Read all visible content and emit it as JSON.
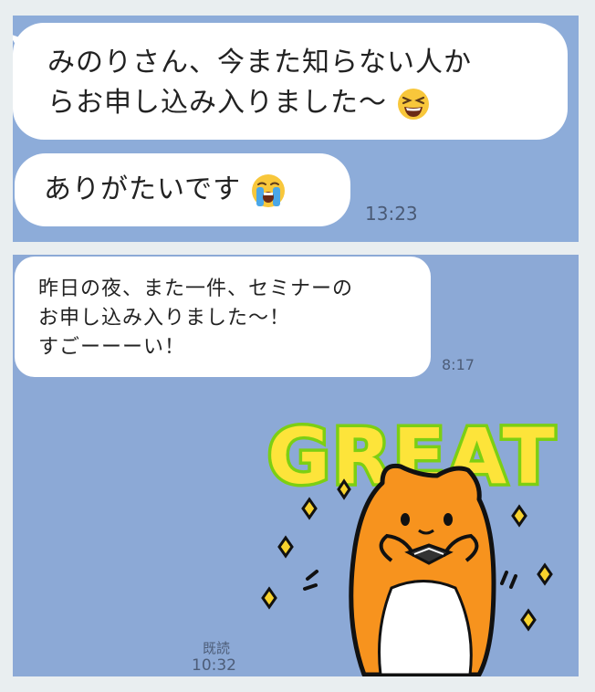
{
  "messages": [
    {
      "lines": [
        "みのりさん、今また知らない人か",
        "らお申し込み入りました〜"
      ],
      "emoji": "laughing-face-icon"
    },
    {
      "text": "ありがたいです",
      "emoji": "crying-face-icon",
      "time": "13:23"
    },
    {
      "lines": [
        "昨日の夜、また一件、セミナーの",
        "お申し込み入りました〜！",
        "すごーーーい！"
      ],
      "time": "8:17"
    }
  ],
  "sticker": {
    "text": "GREAT",
    "icon": "hamster-great-sticker"
  },
  "status": {
    "read": "既読",
    "time": "10:32"
  },
  "colors": {
    "chat_background": "#8dacd9",
    "bubble": "#ffffff",
    "sticker_orange": "#f7931e",
    "sticker_green": "#8bd317"
  }
}
